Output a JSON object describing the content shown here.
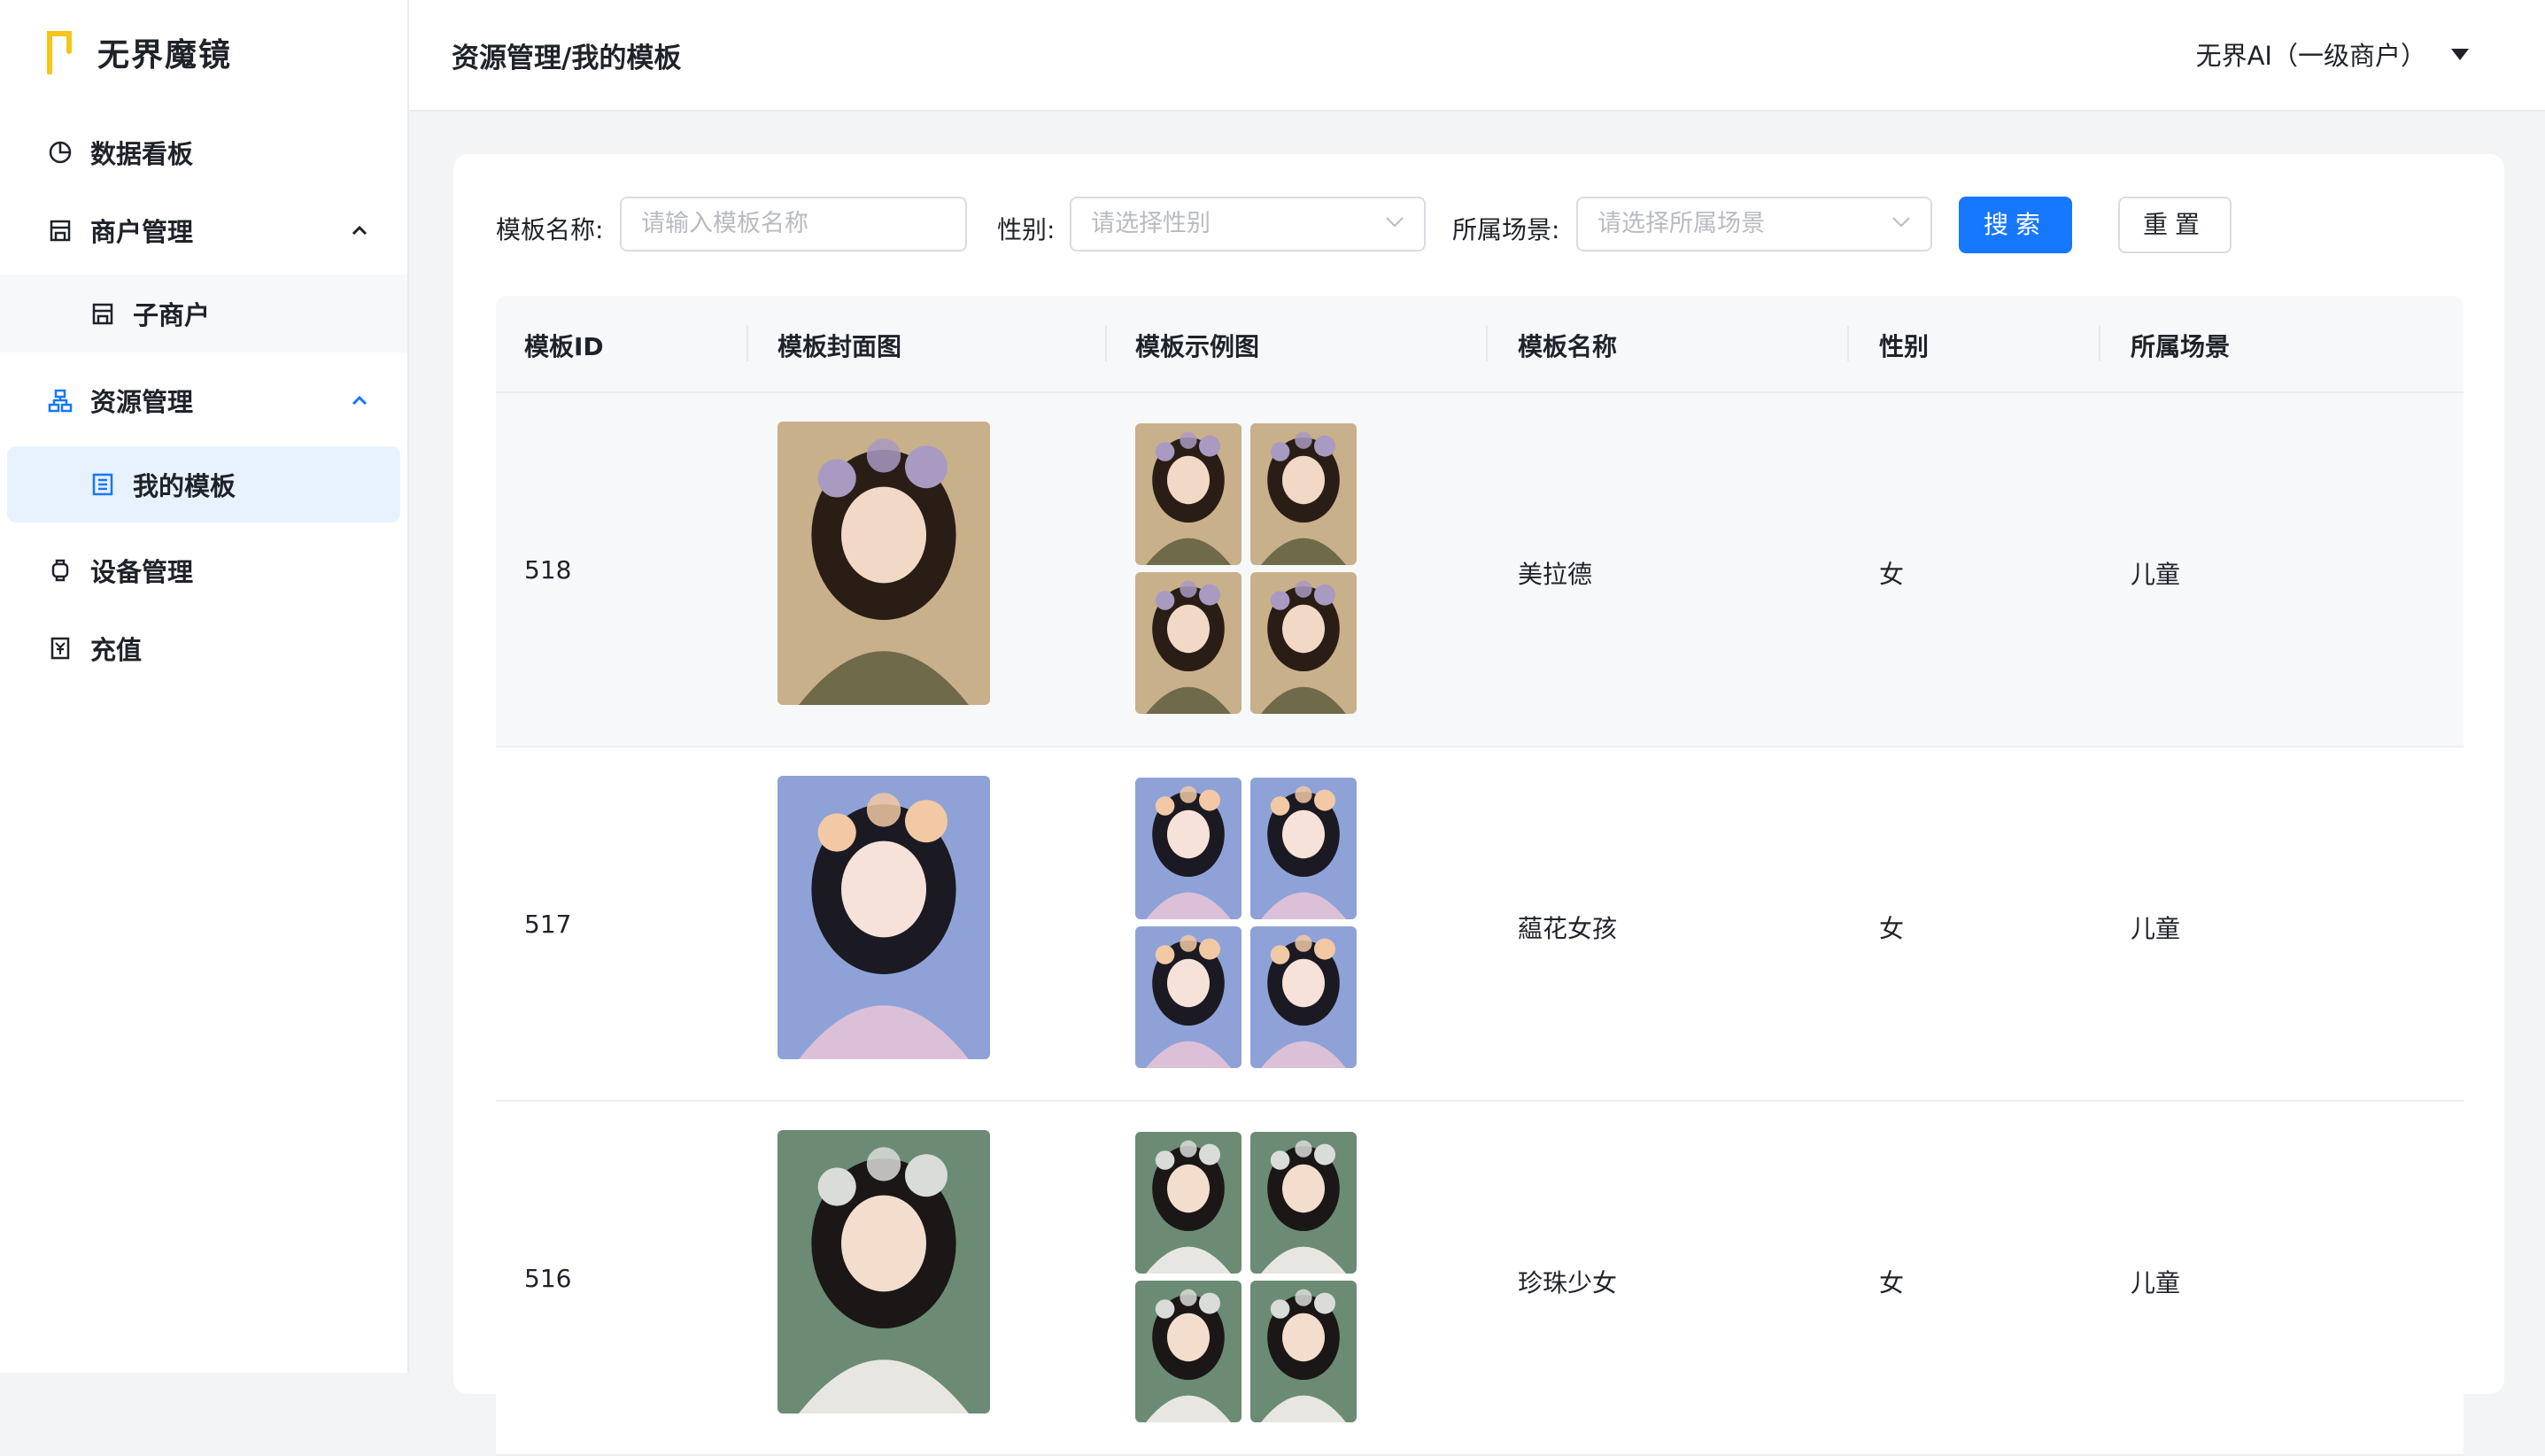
{
  "app": {
    "name": "无界魔镜"
  },
  "sidebar": {
    "items": [
      {
        "label": "数据看板",
        "icon": "pie-chart-icon"
      },
      {
        "label": "商户管理",
        "icon": "store-icon"
      },
      {
        "label": "子商户",
        "icon": "store-icon"
      },
      {
        "label": "资源管理",
        "icon": "org-chart-icon"
      },
      {
        "label": "我的模板",
        "icon": "template-icon"
      },
      {
        "label": "设备管理",
        "icon": "watch-icon"
      },
      {
        "label": "充值",
        "icon": "recharge-icon"
      }
    ]
  },
  "header": {
    "breadcrumb": "资源管理/我的模板",
    "account": "无界AI（一级商户）"
  },
  "filters": {
    "name_label": "模板名称:",
    "name_placeholder": "请输入模板名称",
    "gender_label": "性别:",
    "gender_placeholder": "请选择性别",
    "scene_label": "所属场景:",
    "scene_placeholder": "请选择所属场景",
    "search_button": "搜索",
    "reset_button": "重置"
  },
  "table": {
    "columns": [
      "模板ID",
      "模板封面图",
      "模板示例图",
      "模板名称",
      "性别",
      "所属场景"
    ],
    "rows": [
      {
        "id": "518",
        "name": "美拉德",
        "gender": "女",
        "scene": "儿童",
        "palette": {
          "bg": "#c8b08a",
          "hair": "#2a1d16",
          "skin": "#f1d9c6",
          "cloth": "#6f6a4a",
          "accent": "#a99ac2"
        }
      },
      {
        "id": "517",
        "name": "藴花女孩",
        "gender": "女",
        "scene": "儿童",
        "palette": {
          "bg": "#8fa2d8",
          "hair": "#1b1a22",
          "skin": "#f6e2d8",
          "cloth": "#dcc0d8",
          "accent": "#f2c9a4"
        }
      },
      {
        "id": "516",
        "name": "珍珠少女",
        "gender": "女",
        "scene": "儿童",
        "palette": {
          "bg": "#6b8b74",
          "hair": "#1b1716",
          "skin": "#f3ddcd",
          "cloth": "#e8e6e2",
          "accent": "#d9dcd8"
        }
      }
    ]
  }
}
